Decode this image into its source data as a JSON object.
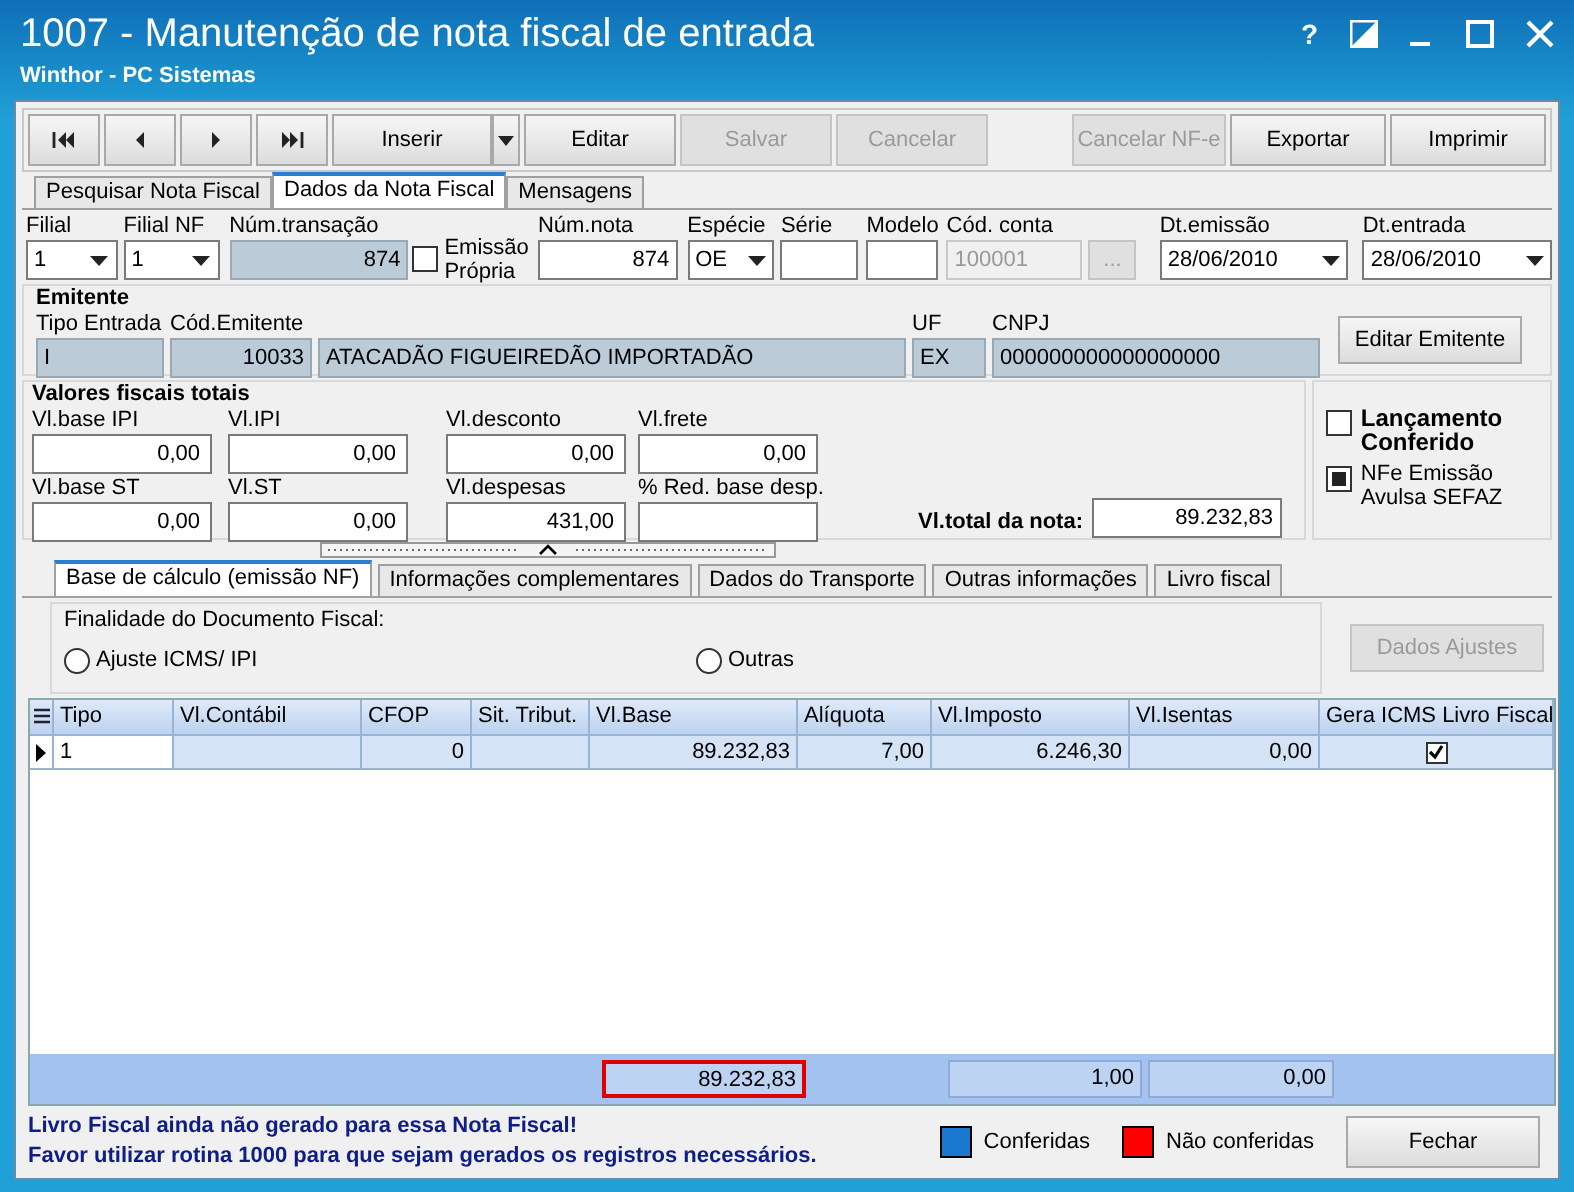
{
  "window": {
    "title": "1007 - Manutenção de nota fiscal de entrada",
    "subtitle": "Winthor - PC Sistemas",
    "help": "?"
  },
  "toolbar": [
    {
      "kind": "nav"
    },
    {
      "kind": "nav"
    },
    {
      "kind": "nav"
    },
    {
      "kind": "nav"
    },
    {
      "kind": "button",
      "label": "Inserir",
      "disabled": false,
      "dropdown": true
    },
    {
      "kind": "button",
      "label": "Editar",
      "disabled": false
    },
    {
      "kind": "button",
      "label": "Salvar",
      "disabled": true
    },
    {
      "kind": "button",
      "label": "Cancelar",
      "disabled": true
    },
    {
      "kind": "spacer"
    },
    {
      "kind": "button",
      "label": "Cancelar NF-e",
      "disabled": true
    },
    {
      "kind": "button",
      "label": "Exportar",
      "disabled": false
    },
    {
      "kind": "button",
      "label": "Imprimir",
      "disabled": false
    }
  ],
  "tabs": [
    {
      "label": "Pesquisar Nota Fiscal",
      "selected": false
    },
    {
      "label": "Dados da Nota Fiscal",
      "selected": true
    },
    {
      "label": "Mensagens",
      "selected": false
    }
  ],
  "header_fields": [
    {
      "kind": "combo",
      "label": "Filial",
      "value": "1"
    },
    {
      "kind": "combo",
      "label": "Filial NF",
      "value": "1"
    },
    {
      "kind": "readonly",
      "label": "Núm.transação",
      "value": "874"
    },
    {
      "kind": "check",
      "label": "Emissão Própria",
      "checked": false
    },
    {
      "kind": "text",
      "label": "Núm.nota",
      "value": "874"
    },
    {
      "kind": "combo",
      "label": "Espécie",
      "value": "OE"
    },
    {
      "kind": "text",
      "label": "Série"
    },
    {
      "kind": "text",
      "label": "Modelo"
    },
    {
      "kind": "lookup",
      "label": "Cód. conta",
      "value": "100001",
      "button": "...",
      "disabled": true
    },
    {
      "kind": "date",
      "label": "Dt.emissão",
      "value": "28/06/2010"
    },
    {
      "kind": "date",
      "label": "Dt.entrada",
      "value": "28/06/2010"
    }
  ],
  "emitente": {
    "title": "Emitente",
    "fields": [
      {
        "label": "Tipo Entrada",
        "value": "I"
      },
      {
        "label": "Cód.Emitente",
        "value": "10033"
      },
      {
        "value": "ATACADÃO FIGUEIREDÃO IMPORTADÃO"
      },
      {
        "label": "UF",
        "value": "EX"
      },
      {
        "label": "CNPJ",
        "value": "000000000000000000"
      }
    ],
    "button": "Editar Emitente"
  },
  "valores": {
    "title": "Valores fiscais totais",
    "rows": [
      [
        {
          "label": "Vl.base IPI",
          "value": "0,00"
        },
        {
          "label": "Vl.IPI",
          "value": "0,00"
        },
        {
          "label": "Vl.desconto",
          "value": "0,00"
        },
        {
          "label": "Vl.frete",
          "value": "0,00"
        }
      ],
      [
        {
          "label": "Vl.base ST",
          "value": "0,00"
        },
        {
          "label": "Vl.ST",
          "value": "0,00"
        },
        {
          "label": "Vl.despesas",
          "value": "431,00"
        },
        {
          "label": "% Red. base desp."
        }
      ]
    ],
    "total_label": "Vl.total da nota:",
    "total_value": "89.232,83"
  },
  "flags": [
    {
      "label": "Lançamento Conferido",
      "checked": false
    },
    {
      "label": "NFe Emissão Avulsa SEFAZ",
      "checked": true
    }
  ],
  "sub_tabs": [
    {
      "label": "Base de cálculo (emissão NF)",
      "selected": true
    },
    {
      "label": "Informações complementares",
      "selected": false
    },
    {
      "label": "Dados do Transporte",
      "selected": false
    },
    {
      "label": "Outras informações",
      "selected": false
    },
    {
      "label": "Livro fiscal",
      "selected": false
    }
  ],
  "finalidade": {
    "title": "Finalidade do Documento Fiscal:",
    "options": [
      {
        "label": "Ajuste ICMS/ IPI",
        "selected": false
      },
      {
        "label": "Outras",
        "selected": false
      }
    ],
    "button": "Dados Ajustes",
    "button_disabled": true
  },
  "table": {
    "columns": [
      "Tipo",
      "Vl.Contábil",
      "CFOP",
      "Sit. Tribut.",
      "Vl.Base",
      "Alíquota",
      "Vl.Imposto",
      "Vl.Isentas",
      "Gera ICMS Livro Fiscal"
    ],
    "rows": [
      {
        "selected": true,
        "cells": [
          "1",
          "",
          "0",
          "",
          "89.232,83",
          "7,00",
          "6.246,30",
          "0,00"
        ],
        "gera_icms": true
      }
    ],
    "footer": {
      "vl_base": {
        "value": "89.232,83",
        "highlighted": true
      },
      "vl_imposto": {
        "value": "1,00",
        "highlighted": false
      },
      "vl_isentas": {
        "value": "0,00",
        "highlighted": false
      }
    }
  },
  "status": {
    "messages": [
      "Livro Fiscal ainda não gerado para essa Nota Fiscal!",
      "Favor utilizar rotina 1000 para que sejam gerados os registros necessários."
    ],
    "legend": [
      {
        "label": "Conferidas",
        "color": "#1a78d0"
      },
      {
        "label": "Não conferidas",
        "color": "#ff0000"
      }
    ],
    "button": "Fechar"
  }
}
